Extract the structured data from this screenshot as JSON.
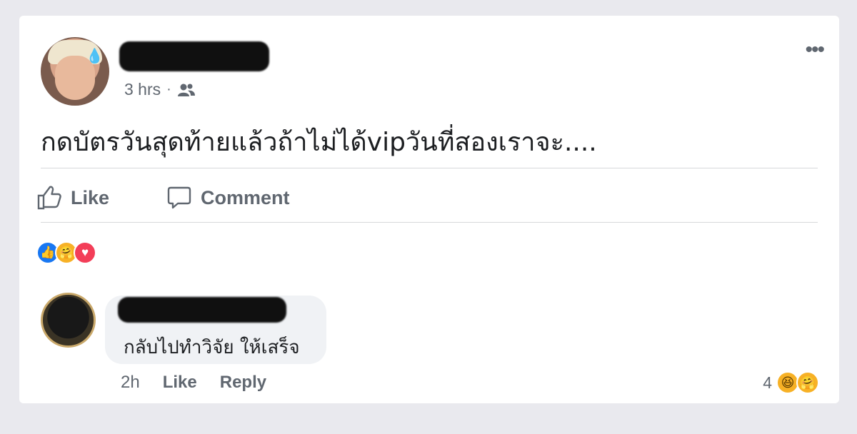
{
  "post": {
    "time": "3 hrs",
    "separator": "·",
    "privacy_icon": "friends-icon",
    "text": "กดบัตรวันสุดท้ายแล้วถ้าไม่ได้vipวันที่สองเราจะ....",
    "more_label": "•••"
  },
  "actions": {
    "like_label": "Like",
    "comment_label": "Comment"
  },
  "reactions": [
    "like-reaction-icon",
    "care-reaction-icon",
    "love-reaction-icon"
  ],
  "comment": {
    "text": "กลับไปทำวิจัย ให้เสร็จ",
    "time": "2h",
    "like_label": "Like",
    "reply_label": "Reply",
    "reaction_count": "4",
    "reactions": [
      "haha-reaction-icon",
      "care-reaction-icon"
    ]
  },
  "colors": {
    "background": "#e9e9ee",
    "card": "#ffffff",
    "muted_text": "#606770",
    "like_blue": "#1877f2",
    "love_red": "#f33e58",
    "care_yellow": "#f7b125"
  }
}
